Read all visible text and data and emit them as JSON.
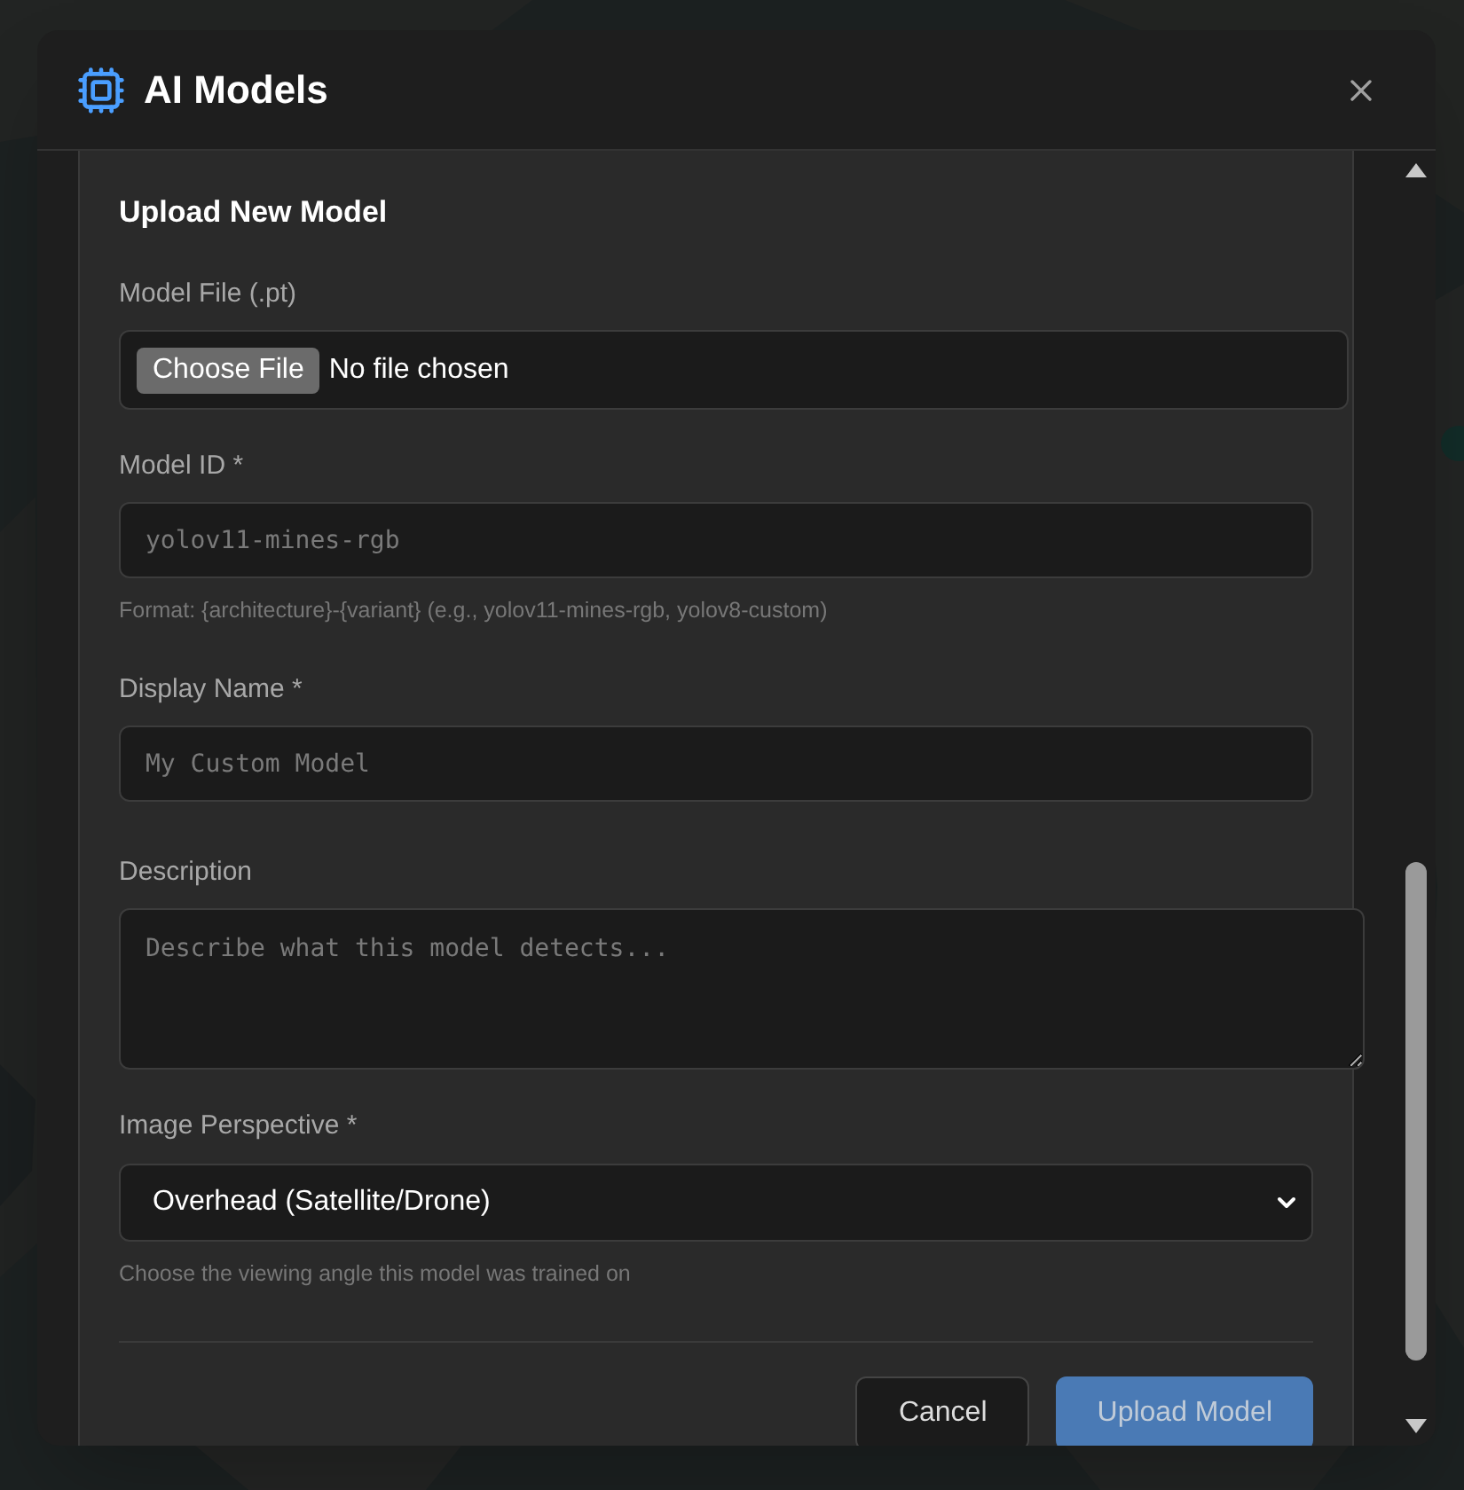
{
  "window": {
    "title": "AI Models"
  },
  "form": {
    "title": "Upload New Model",
    "fields": [
      {
        "kind": "file",
        "label": "Model File (.pt)",
        "button": "Choose File",
        "value": "No file chosen"
      },
      {
        "kind": "text",
        "label": "Model ID *",
        "placeholder": "yolov11-mines-rgb",
        "hint": "Format: {architecture}-{variant} (e.g., yolov11-mines-rgb, yolov8-custom)"
      },
      {
        "kind": "text",
        "label": "Display Name *",
        "placeholder": "My Custom Model"
      },
      {
        "kind": "textarea",
        "label": "Description",
        "placeholder": "Describe what this model detects..."
      },
      {
        "kind": "select",
        "label": "Image Perspective *",
        "value": "Overhead (Satellite/Drone)",
        "hint": "Choose the viewing angle this model was trained on"
      }
    ],
    "buttons": [
      {
        "label": "Cancel",
        "kind": "secondary",
        "disabled": false
      },
      {
        "label": "Upload Model",
        "kind": "primary",
        "disabled": true
      }
    ]
  }
}
